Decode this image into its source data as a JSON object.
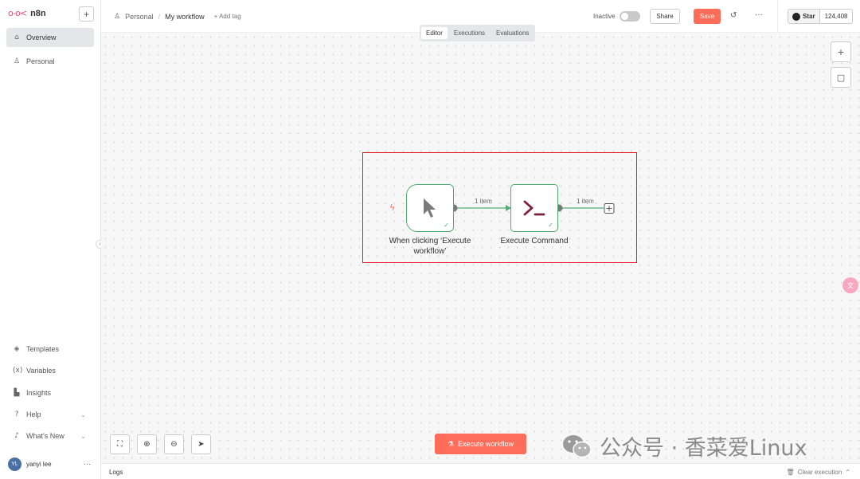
{
  "app": {
    "logo_text": "n8n"
  },
  "sidebar": {
    "items": [
      {
        "label": "Overview",
        "icon": "home-icon"
      },
      {
        "label": "Personal",
        "icon": "user-icon"
      }
    ],
    "bottom_items": [
      {
        "label": "Templates",
        "icon": "box-icon"
      },
      {
        "label": "Variables",
        "icon": "variable-icon"
      },
      {
        "label": "Insights",
        "icon": "chart-icon"
      },
      {
        "label": "Help",
        "icon": "help-icon"
      },
      {
        "label": "What's New",
        "icon": "bell-icon"
      }
    ],
    "user": {
      "initials": "YL",
      "name": "yanyi lee"
    }
  },
  "header": {
    "breadcrumb_project": "Personal",
    "workflow_title": "My workflow",
    "add_tag": "+ Add tag",
    "status_label": "Inactive",
    "share_label": "Share",
    "save_label": "Save",
    "github_star": "Star",
    "github_count": "124,408"
  },
  "tabs": [
    {
      "label": "Editor",
      "active": true
    },
    {
      "label": "Executions",
      "active": false
    },
    {
      "label": "Evaluations",
      "active": false
    }
  ],
  "nodes": {
    "trigger": {
      "label_line1": "When clicking ‘Execute",
      "label_line2": "workflow’"
    },
    "command": {
      "label": "Execute Command"
    },
    "edge1_label": "1 item",
    "edge2_label": "1 item"
  },
  "canvas": {
    "execute_label": "Execute workflow"
  },
  "logs": {
    "label": "Logs",
    "clear_label": "Clear execution"
  },
  "watermark": {
    "text": "公众号 · 香菜爱Linux"
  },
  "colors": {
    "accent": "#ff6d5a",
    "node_border": "#4caf70",
    "brand": "#ea4b71",
    "highlight": "#e02020"
  }
}
